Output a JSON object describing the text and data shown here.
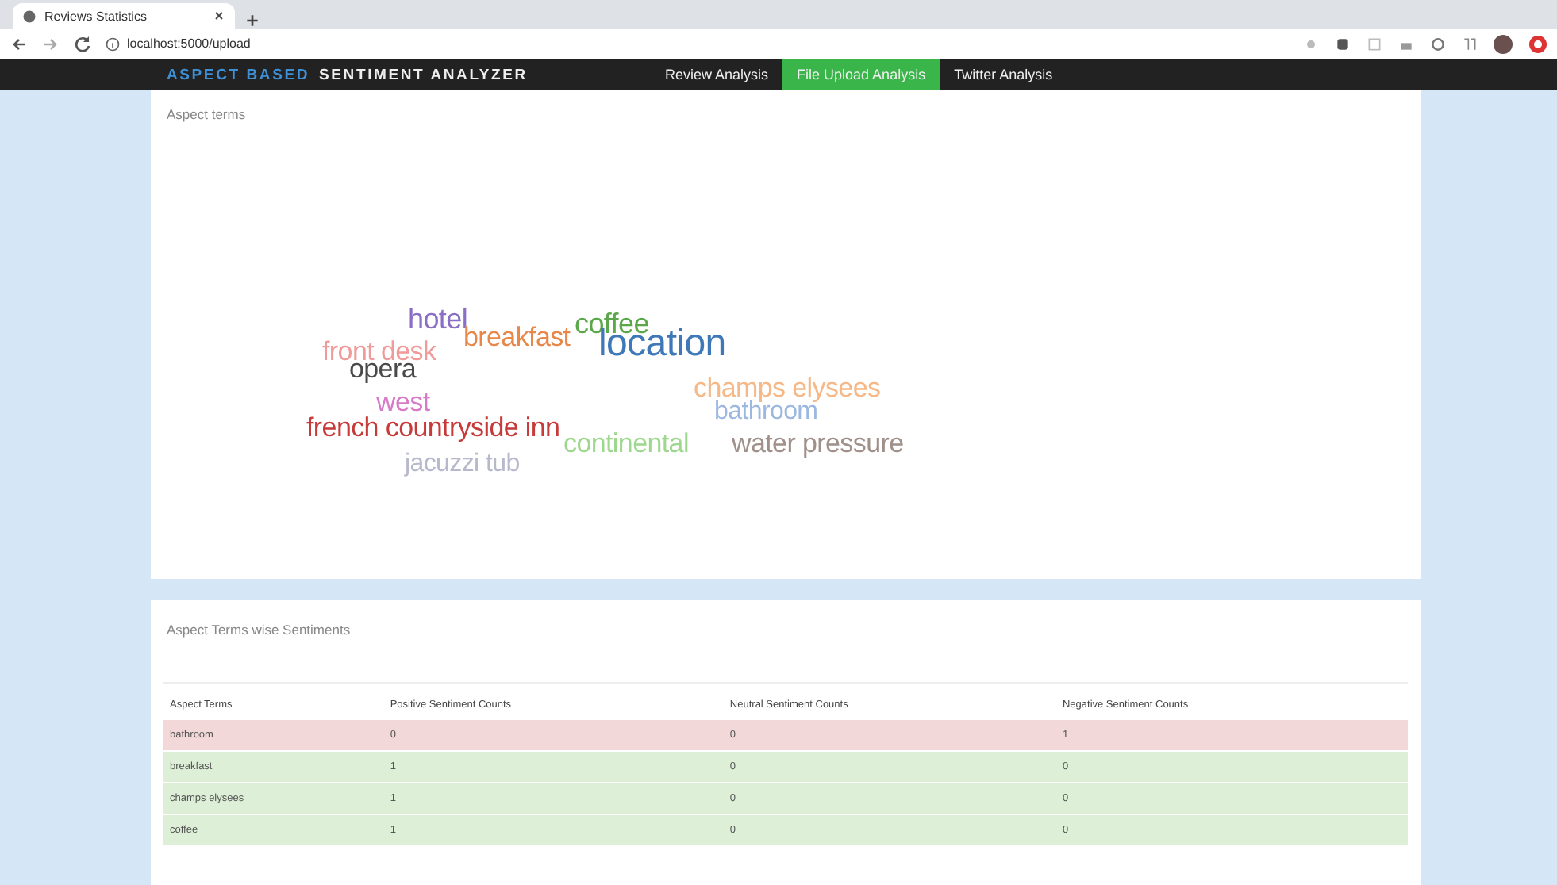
{
  "browser": {
    "tab_title": "Reviews Statistics",
    "url": "localhost:5000/upload"
  },
  "navbar": {
    "brand_highlight": "ASPECT BASED",
    "brand": "SENTIMENT ANALYZER",
    "links": [
      {
        "label": "Review Analysis",
        "selected": false
      },
      {
        "label": "File Upload Analysis",
        "selected": true
      },
      {
        "label": "Twitter Analysis",
        "selected": false
      }
    ]
  },
  "word_cloud": {
    "title": "Aspect terms",
    "words": [
      {
        "text": "hotel",
        "color": "#8a6fc4"
      },
      {
        "text": "coffee",
        "color": "#5aa84a"
      },
      {
        "text": "breakfast",
        "color": "#e8874a"
      },
      {
        "text": "front desk",
        "color": "#f09a9a"
      },
      {
        "text": "location",
        "color": "#3f78b8"
      },
      {
        "text": "opera",
        "color": "#4a4a4a"
      },
      {
        "text": "champs elysees",
        "color": "#f5b886"
      },
      {
        "text": "west",
        "color": "#d77bc9"
      },
      {
        "text": "bathroom",
        "color": "#9cb8e0"
      },
      {
        "text": "french countryside inn",
        "color": "#c73a3a"
      },
      {
        "text": "continental",
        "color": "#9ed88e"
      },
      {
        "text": "water pressure",
        "color": "#a0908a"
      },
      {
        "text": "jacuzzi tub",
        "color": "#b8b8cc"
      }
    ]
  },
  "sentiment_table": {
    "title": "Aspect Terms wise Sentiments",
    "columns": [
      "Aspect Terms",
      "Positive Sentiment Counts",
      "Neutral Sentiment Counts",
      "Negative Sentiment Counts"
    ],
    "rows": [
      {
        "kind": "negative",
        "cells": [
          "bathroom",
          "0",
          "0",
          "1"
        ]
      },
      {
        "kind": "positive",
        "cells": [
          "breakfast",
          "1",
          "0",
          "0"
        ]
      },
      {
        "kind": "positive",
        "cells": [
          "champs elysees",
          "1",
          "0",
          "0"
        ]
      },
      {
        "kind": "positive",
        "cells": [
          "coffee",
          "1",
          "0",
          "0"
        ]
      }
    ]
  }
}
